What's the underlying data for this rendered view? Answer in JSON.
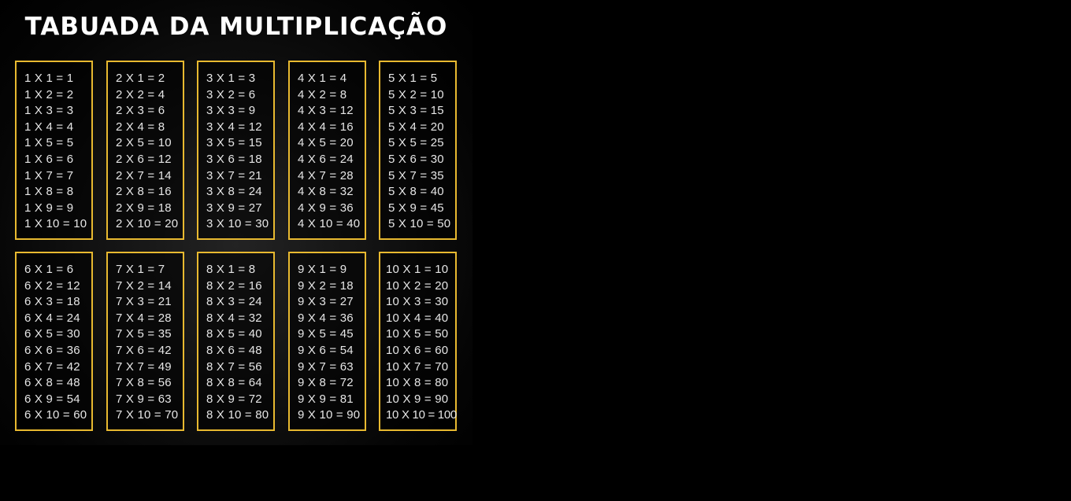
{
  "title": "TABUADA DA MULTIPLICAÇÃO",
  "colors": {
    "background": "#000000",
    "card_border": "#e8b930",
    "title_text": "#ffffff",
    "row_text": "#e6e6e6"
  },
  "tables": [
    {
      "rows": [
        "1 X 1 = 1",
        "1 X 2 = 2",
        "1 X 3 = 3",
        "1 X 4 = 4",
        "1 X 5 = 5",
        "1 X 6 = 6",
        "1 X 7 = 7",
        "1 X 8 = 8",
        "1 X 9 = 9",
        "1 X 10 = 10"
      ]
    },
    {
      "rows": [
        "2 X 1 = 2",
        "2 X 2 = 4",
        "2 X 3 = 6",
        "2 X 4 = 8",
        "2 X 5 = 10",
        "2 X 6 = 12",
        "2 X 7 = 14",
        "2 X 8 = 16",
        "2 X 9 = 18",
        "2 X 10 = 20"
      ]
    },
    {
      "rows": [
        "3 X 1 = 3",
        "3 X 2 = 6",
        "3 X 3 = 9",
        "3 X 4 = 12",
        "3 X 5 = 15",
        "3 X 6 = 18",
        "3 X 7 = 21",
        "3 X 8 = 24",
        "3 X 9 = 27",
        "3 X 10 = 30"
      ]
    },
    {
      "rows": [
        "4 X 1 = 4",
        "4 X 2 = 8",
        "4 X 3 = 12",
        "4 X 4 = 16",
        "4 X 5 = 20",
        "4 X 6 = 24",
        "4 X 7 = 28",
        "4 X 8 = 32",
        "4 X 9 = 36",
        "4 X 10 = 40"
      ]
    },
    {
      "rows": [
        "5 X 1 = 5",
        "5 X 2 = 10",
        "5 X 3 = 15",
        "5 X 4 = 20",
        "5 X 5 = 25",
        "5 X 6 = 30",
        "5 X 7 = 35",
        "5 X 8 = 40",
        "5 X 9 = 45",
        "5 X 10 = 50"
      ]
    },
    {
      "rows": [
        "6 X 1 = 6",
        "6 X 2 = 12",
        "6 X 3 = 18",
        "6 X 4 = 24",
        "6 X 5 = 30",
        "6 X 6 = 36",
        "6 X 7 = 42",
        "6 X 8 = 48",
        "6 X 9 = 54",
        "6 X 10 = 60"
      ]
    },
    {
      "rows": [
        "7 X 1 = 7",
        "7 X 2 = 14",
        "7 X 3 = 21",
        "7 X 4 = 28",
        "7 X 5 = 35",
        "7 X 6 = 42",
        "7 X 7 = 49",
        "7 X 8 = 56",
        "7 X 9 = 63",
        "7 X 10 = 70"
      ]
    },
    {
      "rows": [
        "8 X 1 = 8",
        "8 X 2 = 16",
        "8 X 3 = 24",
        "8 X 4 = 32",
        "8 X 5 = 40",
        "8 X 6 = 48",
        "8 X 7 = 56",
        "8 X 8 = 64",
        "8 X 9 = 72",
        "8 X 10 = 80"
      ]
    },
    {
      "rows": [
        "9 X 1 = 9",
        "9 X 2 = 18",
        "9 X 3 = 27",
        "9 X 4 = 36",
        "9 X 5 = 45",
        "9 X 6 = 54",
        "9 X 7 = 63",
        "9 X 8 = 72",
        "9 X 9 = 81",
        "9 X 10 = 90"
      ]
    },
    {
      "rows": [
        "10 X 1 = 10",
        "10 X 2 = 20",
        "10 X 3 = 30",
        "10 X 4 = 40",
        "10 X 5 = 50",
        "10 X 6 = 60",
        "10 X 7 = 70",
        "10 X 8 = 80",
        "10 X 9 = 90",
        "10 X 10 = 100"
      ]
    }
  ]
}
